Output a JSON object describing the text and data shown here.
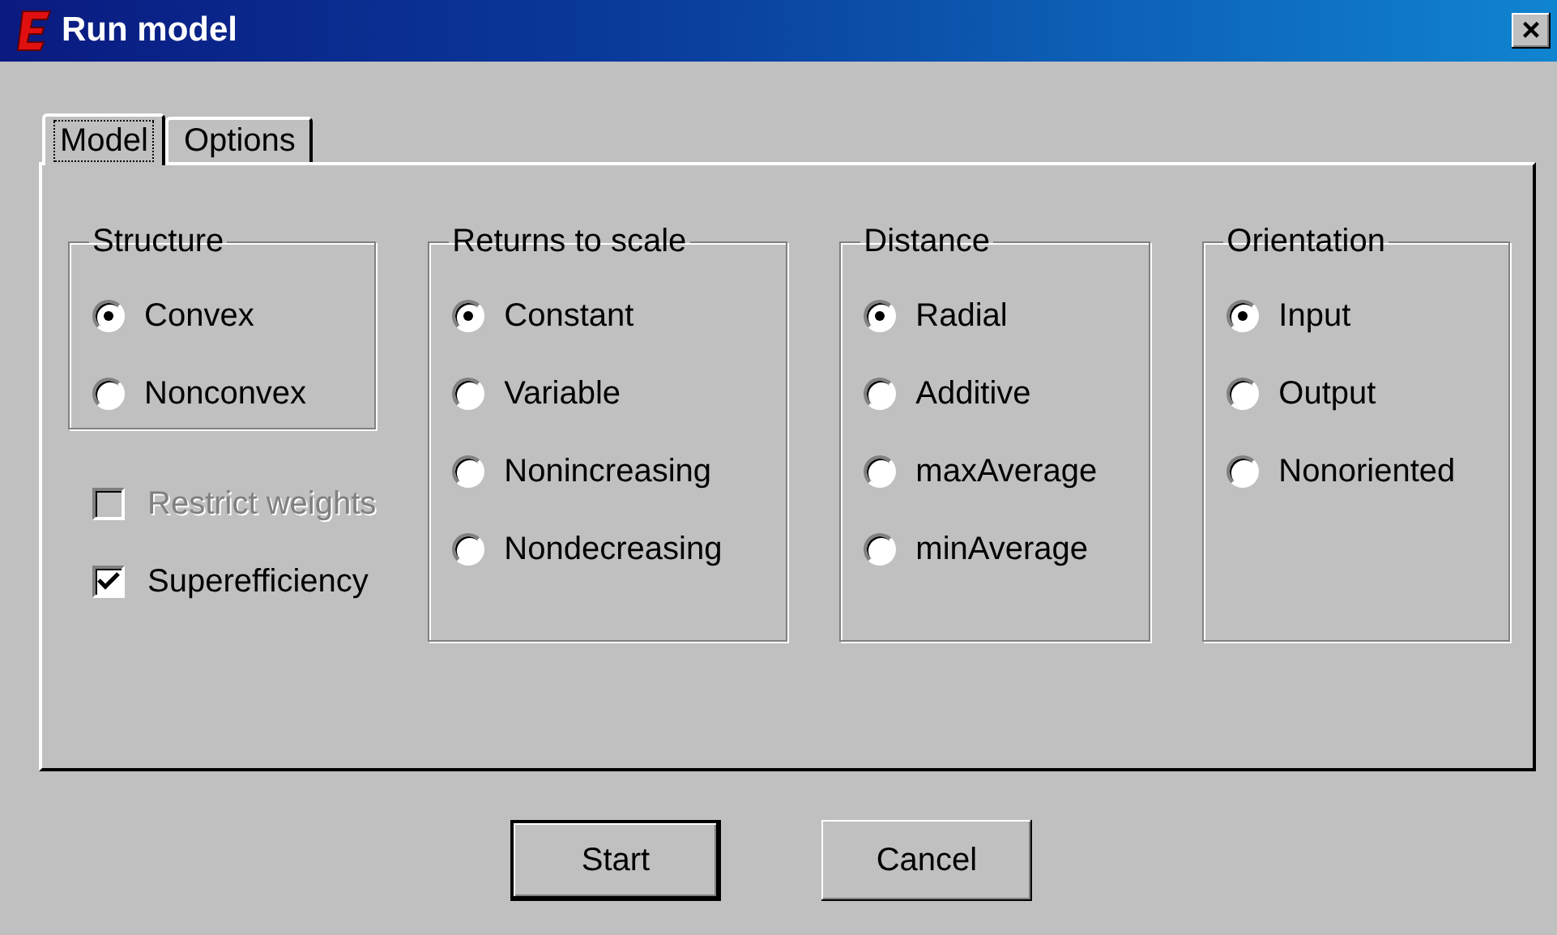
{
  "window": {
    "title": "Run model",
    "close_label": "×"
  },
  "tabs": [
    {
      "label": "Model",
      "selected": true
    },
    {
      "label": "Options",
      "selected": false
    }
  ],
  "groups": [
    {
      "title": "Structure",
      "options": [
        {
          "label": "Convex",
          "selected": true
        },
        {
          "label": "Nonconvex",
          "selected": false
        }
      ]
    },
    {
      "title": "Returns to scale",
      "options": [
        {
          "label": "Constant",
          "selected": true
        },
        {
          "label": "Variable",
          "selected": false
        },
        {
          "label": "Nonincreasing",
          "selected": false
        },
        {
          "label": "Nondecreasing",
          "selected": false
        }
      ]
    },
    {
      "title": "Distance",
      "options": [
        {
          "label": "Radial",
          "selected": true
        },
        {
          "label": "Additive",
          "selected": false
        },
        {
          "label": "maxAverage",
          "selected": false
        },
        {
          "label": "minAverage",
          "selected": false
        }
      ]
    },
    {
      "title": "Orientation",
      "options": [
        {
          "label": "Input",
          "selected": true
        },
        {
          "label": "Output",
          "selected": false
        },
        {
          "label": "Nonoriented",
          "selected": false
        }
      ]
    }
  ],
  "checkboxes": [
    {
      "label": "Restrict weights",
      "checked": false,
      "disabled": true
    },
    {
      "label": "Superefficiency",
      "checked": true,
      "disabled": false
    }
  ],
  "buttons": [
    {
      "label": "Start",
      "default": true
    },
    {
      "label": "Cancel",
      "default": false
    }
  ]
}
